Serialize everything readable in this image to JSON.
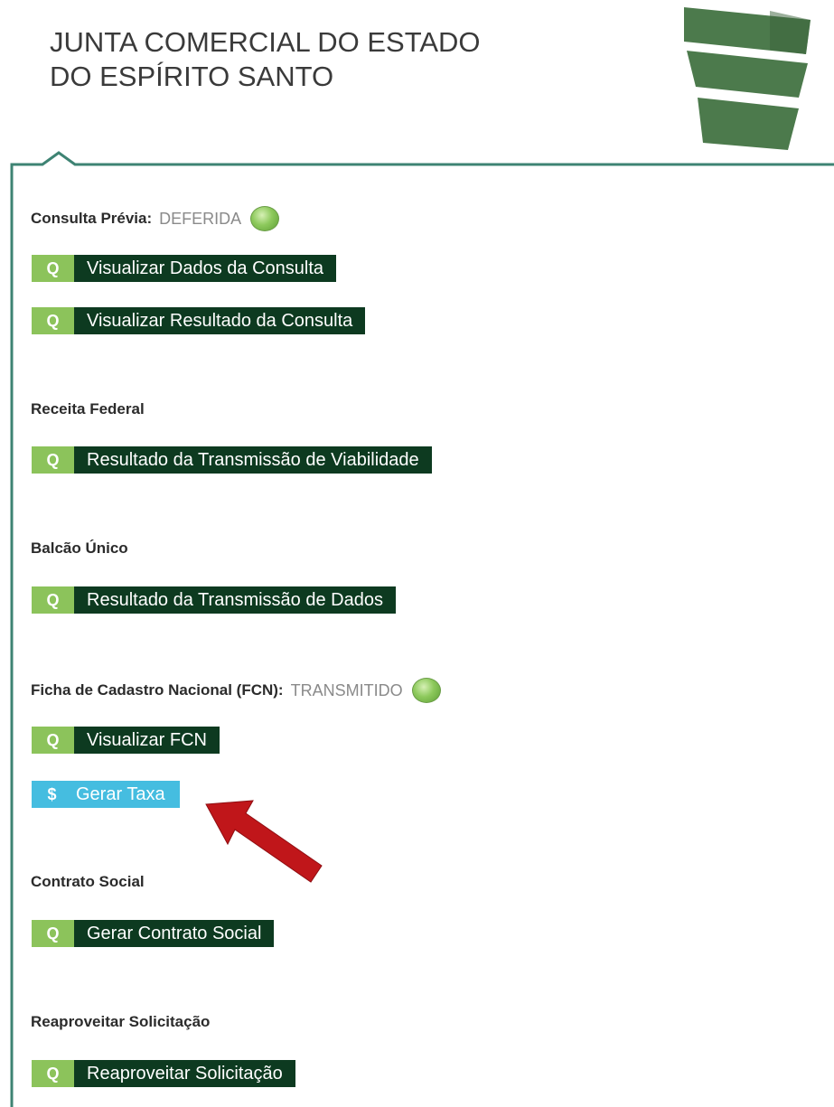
{
  "header": {
    "title_line1": "JUNTA COMERCIAL DO ESTADO",
    "title_line2": "DO ESPÍRITO SANTO"
  },
  "colors": {
    "dark_green": "#0d3a20",
    "light_green": "#8cc35b",
    "cyan": "#45bde0",
    "frame_teal": "#3e8373",
    "arrow_red": "#c0161a"
  },
  "icons": {
    "search": "Q",
    "dollar": "$"
  },
  "sections": {
    "consulta": {
      "label": "Consulta Prévia:",
      "status": "DEFERIDA",
      "buttons": [
        "Visualizar Dados da Consulta",
        "Visualizar Resultado da Consulta"
      ]
    },
    "receita": {
      "label": "Receita Federal",
      "buttons": [
        "Resultado da Transmissão de Viabilidade"
      ]
    },
    "balcao": {
      "label": "Balcão Único",
      "buttons": [
        "Resultado da Transmissão de Dados"
      ]
    },
    "fcn": {
      "label": "Ficha de Cadastro Nacional (FCN):",
      "status": "TRANSMITIDO",
      "buttons": [
        "Visualizar FCN",
        "Gerar Taxa"
      ]
    },
    "contrato": {
      "label": "Contrato Social",
      "buttons": [
        "Gerar Contrato Social"
      ]
    },
    "reaproveitar": {
      "label": "Reaproveitar Solicitação",
      "buttons": [
        "Reaproveitar Solicitação"
      ]
    }
  }
}
